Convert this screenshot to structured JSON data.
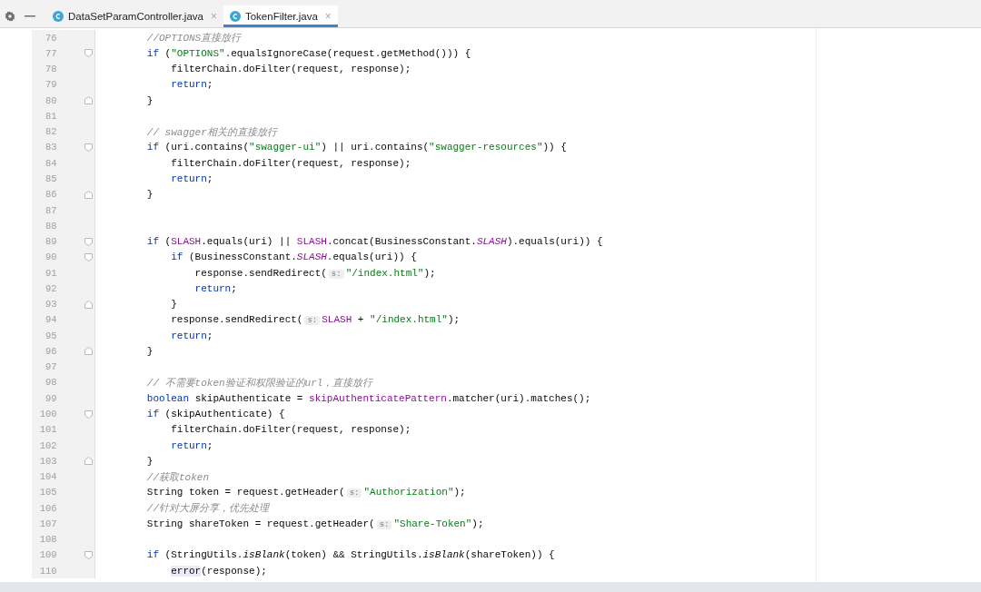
{
  "tabs": [
    {
      "label": "DataSetParamController.java",
      "close": "×",
      "selected": false
    },
    {
      "label": "TokenFilter.java",
      "close": "×",
      "selected": true
    }
  ],
  "lines": [
    {
      "n": "76",
      "kind": "code",
      "tokens": [
        {
          "kind": "comment",
          "text": "        //OPTIONS直接放行"
        }
      ]
    },
    {
      "n": "77",
      "kind": "fold-start",
      "tokens": [
        {
          "kind": "kw",
          "text": "        if"
        },
        {
          "kind": "plain",
          "text": " ("
        },
        {
          "kind": "str",
          "text": "\"OPTIONS\""
        },
        {
          "kind": "plain",
          "text": ".equalsIgnoreCase(request.getMethod())) {"
        }
      ]
    },
    {
      "n": "78",
      "kind": "code",
      "tokens": [
        {
          "kind": "plain",
          "text": "            filterChain.doFilter(request, response);"
        }
      ]
    },
    {
      "n": "79",
      "kind": "code",
      "tokens": [
        {
          "kind": "kw",
          "text": "            return"
        },
        {
          "kind": "plain",
          "text": ";"
        }
      ]
    },
    {
      "n": "80",
      "kind": "fold-end",
      "tokens": [
        {
          "kind": "plain",
          "text": "        }"
        }
      ]
    },
    {
      "n": "81",
      "kind": "code"
    },
    {
      "n": "82",
      "kind": "code",
      "tokens": [
        {
          "kind": "comment",
          "text": "        // swagger相关的直接放行"
        }
      ]
    },
    {
      "n": "83",
      "kind": "fold-start",
      "tokens": [
        {
          "kind": "kw",
          "text": "        if"
        },
        {
          "kind": "plain",
          "text": " (uri.contains("
        },
        {
          "kind": "str",
          "text": "\"swagger-ui\""
        },
        {
          "kind": "plain",
          "text": ") || uri.contains("
        },
        {
          "kind": "str",
          "text": "\"swagger-resources\""
        },
        {
          "kind": "plain",
          "text": ")) {"
        }
      ]
    },
    {
      "n": "84",
      "kind": "code",
      "tokens": [
        {
          "kind": "plain",
          "text": "            filterChain.doFilter(request, response);"
        }
      ]
    },
    {
      "n": "85",
      "kind": "code",
      "tokens": [
        {
          "kind": "kw",
          "text": "            return"
        },
        {
          "kind": "plain",
          "text": ";"
        }
      ]
    },
    {
      "n": "86",
      "kind": "fold-end",
      "tokens": [
        {
          "kind": "plain",
          "text": "        }"
        }
      ]
    },
    {
      "n": "87",
      "kind": "code"
    },
    {
      "n": "88",
      "kind": "code"
    },
    {
      "n": "89",
      "kind": "fold-start",
      "tokens": [
        {
          "kind": "kw",
          "text": "        if"
        },
        {
          "kind": "plain",
          "text": " ("
        },
        {
          "kind": "field",
          "text": "SLASH"
        },
        {
          "kind": "plain",
          "text": ".equals(uri) || "
        },
        {
          "kind": "field",
          "text": "SLASH"
        },
        {
          "kind": "plain",
          "text": ".concat(BusinessConstant."
        },
        {
          "kind": "static",
          "text": "SLASH"
        },
        {
          "kind": "plain",
          "text": ").equals(uri)) {"
        }
      ]
    },
    {
      "n": "90",
      "kind": "fold-start",
      "tokens": [
        {
          "kind": "kw",
          "text": "            if"
        },
        {
          "kind": "plain",
          "text": " (BusinessConstant."
        },
        {
          "kind": "static",
          "text": "SLASH"
        },
        {
          "kind": "plain",
          "text": ".equals(uri)) {"
        }
      ]
    },
    {
      "n": "91",
      "kind": "code",
      "tokens": [
        {
          "kind": "plain",
          "text": "                response.sendRedirect("
        },
        {
          "kind": "hint",
          "text": "s:"
        },
        {
          "kind": "str",
          "text": "\"/index.html\""
        },
        {
          "kind": "plain",
          "text": ");"
        }
      ]
    },
    {
      "n": "92",
      "kind": "code",
      "tokens": [
        {
          "kind": "kw",
          "text": "                return"
        },
        {
          "kind": "plain",
          "text": ";"
        }
      ]
    },
    {
      "n": "93",
      "kind": "fold-end",
      "tokens": [
        {
          "kind": "plain",
          "text": "            }"
        }
      ]
    },
    {
      "n": "94",
      "kind": "code",
      "tokens": [
        {
          "kind": "plain",
          "text": "            response.sendRedirect("
        },
        {
          "kind": "hint",
          "text": "s:"
        },
        {
          "kind": "field",
          "text": "SLASH"
        },
        {
          "kind": "plain",
          "text": " + "
        },
        {
          "kind": "str",
          "text": "\"/index.html\""
        },
        {
          "kind": "plain",
          "text": ");"
        }
      ]
    },
    {
      "n": "95",
      "kind": "code",
      "tokens": [
        {
          "kind": "kw",
          "text": "            return"
        },
        {
          "kind": "plain",
          "text": ";"
        }
      ]
    },
    {
      "n": "96",
      "kind": "fold-end",
      "tokens": [
        {
          "kind": "plain",
          "text": "        }"
        }
      ]
    },
    {
      "n": "97",
      "kind": "code"
    },
    {
      "n": "98",
      "kind": "code",
      "tokens": [
        {
          "kind": "comment",
          "text": "        // 不需要token验证和权限验证的url，直接放行"
        }
      ]
    },
    {
      "n": "99",
      "kind": "code",
      "tokens": [
        {
          "kind": "kw",
          "text": "        boolean"
        },
        {
          "kind": "plain",
          "text": " skipAuthenticate = "
        },
        {
          "kind": "field",
          "text": "skipAuthenticatePattern"
        },
        {
          "kind": "plain",
          "text": ".matcher(uri).matches();"
        }
      ]
    },
    {
      "n": "100",
      "kind": "fold-start",
      "tokens": [
        {
          "kind": "kw",
          "text": "        if"
        },
        {
          "kind": "plain",
          "text": " (skipAuthenticate) {"
        }
      ]
    },
    {
      "n": "101",
      "kind": "code",
      "tokens": [
        {
          "kind": "plain",
          "text": "            filterChain.doFilter(request, response);"
        }
      ]
    },
    {
      "n": "102",
      "kind": "code",
      "tokens": [
        {
          "kind": "kw",
          "text": "            return"
        },
        {
          "kind": "plain",
          "text": ";"
        }
      ]
    },
    {
      "n": "103",
      "kind": "fold-end",
      "tokens": [
        {
          "kind": "plain",
          "text": "        }"
        }
      ]
    },
    {
      "n": "104",
      "kind": "code",
      "tokens": [
        {
          "kind": "comment",
          "text": "        //获取token"
        }
      ]
    },
    {
      "n": "105",
      "kind": "code",
      "tokens": [
        {
          "kind": "plain",
          "text": "        String token = request.getHeader("
        },
        {
          "kind": "hint",
          "text": "s:"
        },
        {
          "kind": "str",
          "text": "\"Authorization\""
        },
        {
          "kind": "plain",
          "text": ");"
        }
      ]
    },
    {
      "n": "106",
      "kind": "code",
      "tokens": [
        {
          "kind": "comment",
          "text": "        //针对大屏分享，优先处理"
        }
      ]
    },
    {
      "n": "107",
      "kind": "code",
      "tokens": [
        {
          "kind": "plain",
          "text": "        String shareToken = request.getHeader("
        },
        {
          "kind": "hint",
          "text": "s:"
        },
        {
          "kind": "str",
          "text": "\"Share-Token\""
        },
        {
          "kind": "plain",
          "text": ");"
        }
      ]
    },
    {
      "n": "108",
      "kind": "code"
    },
    {
      "n": "109",
      "kind": "fold-start",
      "tokens": [
        {
          "kind": "kw",
          "text": "        if"
        },
        {
          "kind": "plain",
          "text": " (StringUtils."
        },
        {
          "kind": "italic",
          "text": "isBlank"
        },
        {
          "kind": "plain",
          "text": "(token) && StringUtils."
        },
        {
          "kind": "italic",
          "text": "isBlank"
        },
        {
          "kind": "plain",
          "text": "(shareToken)) {"
        }
      ]
    },
    {
      "n": "110",
      "kind": "code",
      "tokens": [
        {
          "kind": "highlight",
          "text": "            error"
        },
        {
          "kind": "plain",
          "text": "(response);"
        }
      ]
    }
  ]
}
